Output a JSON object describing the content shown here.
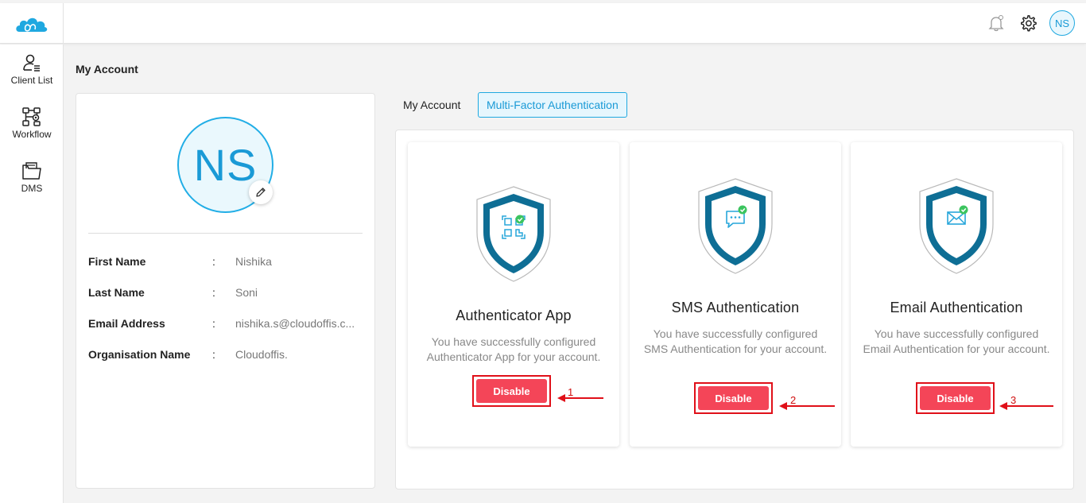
{
  "header": {
    "logo": "cloud-logo-icon",
    "bell_icon": "bell-icon",
    "settings_icon": "gear-icon",
    "user_initials": "NS"
  },
  "sidebar": {
    "items": [
      {
        "label": "Client List",
        "icon": "user-list-icon"
      },
      {
        "label": "Workflow",
        "icon": "workflow-icon"
      },
      {
        "label": "DMS",
        "icon": "folder-icon"
      }
    ]
  },
  "page_title": "My Account",
  "profile": {
    "initials": "NS",
    "edit_icon": "pencil-icon",
    "fields": [
      {
        "label": "First Name",
        "colon": ":",
        "value": "Nishika"
      },
      {
        "label": "Last Name",
        "colon": ":",
        "value": "Soni"
      },
      {
        "label": "Email Address",
        "colon": ":",
        "value": "nishika.s@cloudoffis.c..."
      },
      {
        "label": "Organisation Name",
        "colon": ":",
        "value": "Cloudoffis."
      }
    ]
  },
  "tabs": [
    {
      "label": "My Account",
      "active": false
    },
    {
      "label": "Multi-Factor Authentication",
      "active": true
    }
  ],
  "mfa_cards": [
    {
      "title": "Authenticator App",
      "description": "You have successfully configured Authenticator App for your account.",
      "button": "Disable",
      "icon": "qr-code-shield-icon",
      "annotation": "1"
    },
    {
      "title": "SMS Authentication",
      "description": "You have successfully configured SMS Authentication for your account.",
      "button": "Disable",
      "icon": "chat-shield-icon",
      "annotation": "2"
    },
    {
      "title": "Email Authentication",
      "description": "You have successfully configured Email Authentication for your account.",
      "button": "Disable",
      "icon": "envelope-shield-icon",
      "annotation": "3"
    }
  ],
  "colors": {
    "accent": "#1fa8e0",
    "disable_button": "#f44558",
    "annotation_red": "#e01019",
    "shield_dark": "#0e6e95",
    "check_green": "#3cc45f"
  }
}
